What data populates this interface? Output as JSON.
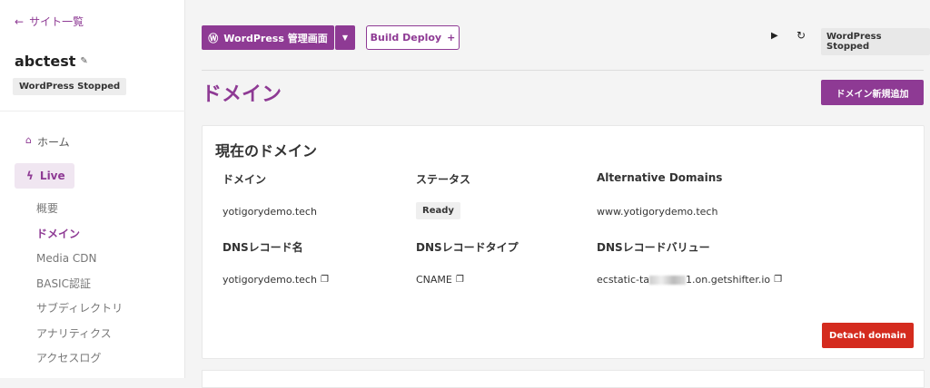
{
  "sidebar": {
    "back_label": "サイト一覧",
    "site_name": "abctest",
    "site_status": "WordPress Stopped",
    "home_label": "ホーム",
    "live_label": "Live",
    "subnav": [
      "概要",
      "ドメイン",
      "Media CDN",
      "BASIC認証",
      "サブディレクトリ",
      "アナリティクス",
      "アクセスログ"
    ]
  },
  "toolbar": {
    "wp_admin_label": "WordPress 管理画面",
    "build_deploy_label": "Build Deploy",
    "status": "WordPress Stopped"
  },
  "page": {
    "title": "ドメイン",
    "add_domain_label": "ドメイン新規追加"
  },
  "card": {
    "title": "現在のドメイン",
    "headers": [
      "ドメイン",
      "ステータス",
      "Alternative Domains"
    ],
    "domain": "yotigorydemo.tech",
    "status": "Ready",
    "alt_domain": "www.yotigorydemo.tech",
    "dns_headers": [
      "DNSレコード名",
      "DNSレコードタイプ",
      "DNSレコードバリュー"
    ],
    "dns_name": "yotigorydemo.tech",
    "dns_type": "CNAME",
    "dns_value_prefix": "ecstatic-ta",
    "dns_value_suffix": "1.on.getshifter.io",
    "detach_label": "Detach domain"
  },
  "colors": {
    "accent": "#8e3a94",
    "danger": "#d42b1e"
  }
}
